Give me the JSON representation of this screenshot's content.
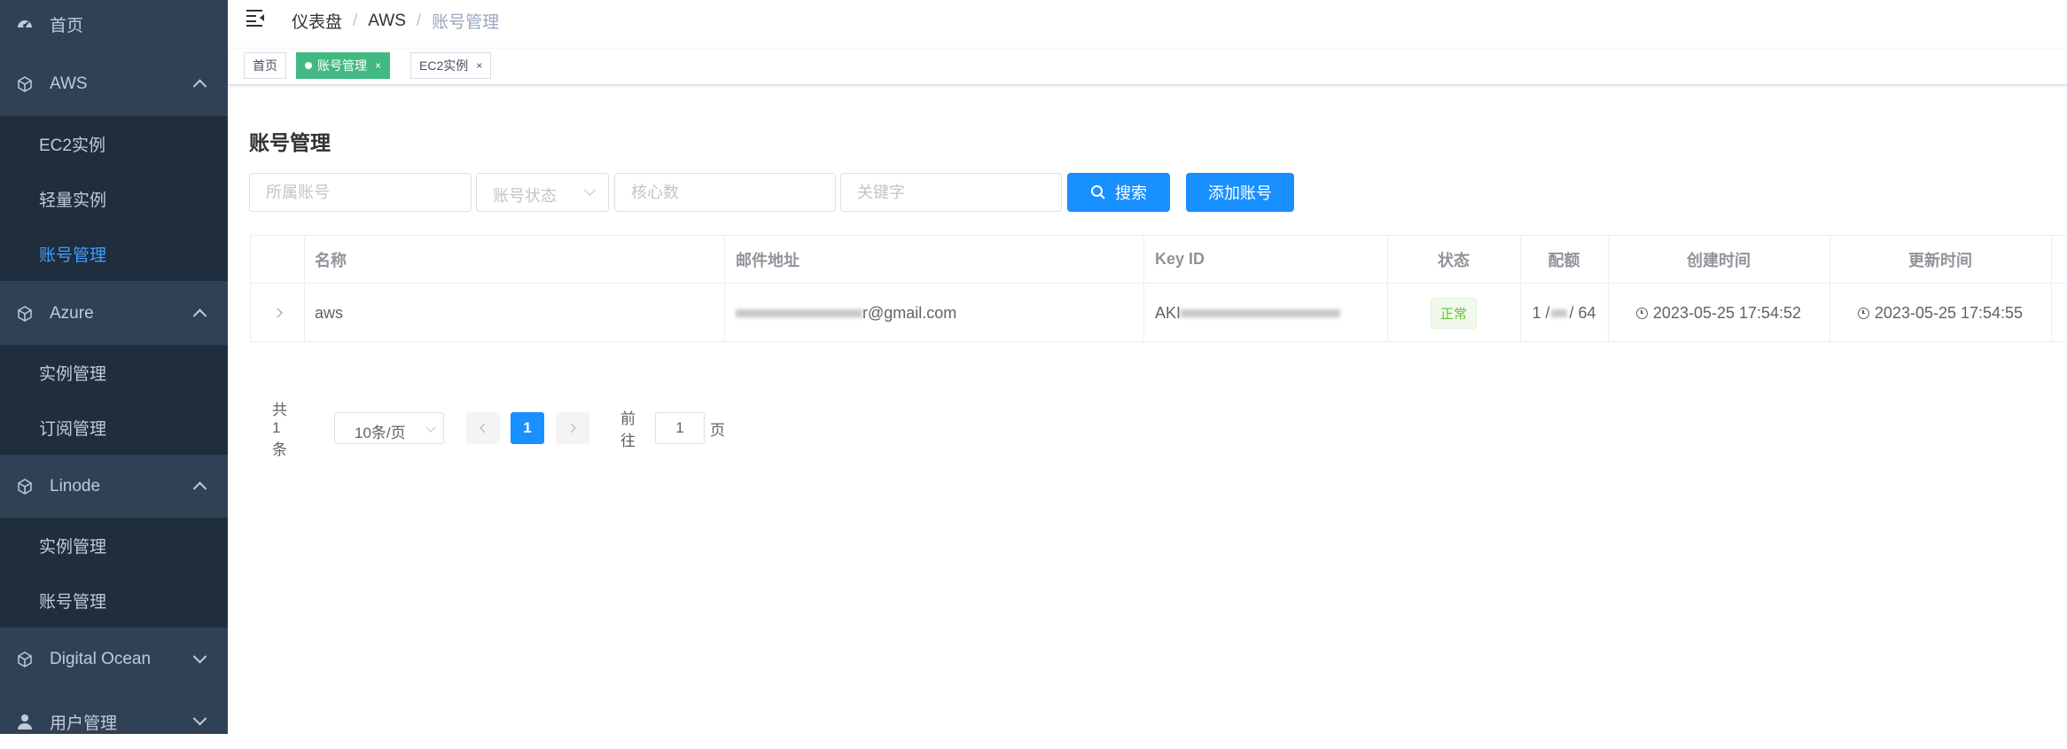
{
  "sidebar": {
    "home": "首页",
    "groups": [
      {
        "label": "AWS",
        "items": [
          "EC2实例",
          "轻量实例",
          "账号管理"
        ]
      },
      {
        "label": "Azure",
        "items": [
          "实例管理",
          "订阅管理"
        ]
      },
      {
        "label": "Linode",
        "items": [
          "实例管理",
          "账号管理"
        ]
      },
      {
        "label": "Digital Ocean"
      },
      {
        "label": "用户管理"
      }
    ],
    "active_color": "#409eff"
  },
  "breadcrumb": [
    "仪表盘",
    "AWS",
    "账号管理"
  ],
  "tags": [
    {
      "label": "首页",
      "active": false
    },
    {
      "label": "账号管理",
      "active": true,
      "close": "×"
    },
    {
      "label": "EC2实例",
      "active": false,
      "close": "×"
    }
  ],
  "page_title": "账号管理",
  "filters": {
    "account_placeholder": "所属账号",
    "status_placeholder": "账号状态",
    "cores_placeholder": "核心数",
    "keyword_placeholder": "关键字",
    "search_label": "搜索",
    "add_label": "添加账号"
  },
  "table": {
    "columns": [
      "名称",
      "邮件地址",
      "Key ID",
      "状态",
      "配额",
      "创建时间",
      "更新时间"
    ],
    "rows": [
      {
        "name": "aws",
        "email_visible": "r@gmail.com",
        "key_id_visible": "AKI",
        "status": "正常",
        "quota_left": "1 /",
        "quota_right": "/ 64",
        "created": "2023-05-25 17:54:52",
        "updated": "2023-05-25 17:54:55"
      }
    ]
  },
  "pagination": {
    "total": "共 1 条",
    "page_size": "10条/页",
    "current": "1",
    "goto_label": "前往",
    "goto_value": "1",
    "page_suffix": "页"
  }
}
